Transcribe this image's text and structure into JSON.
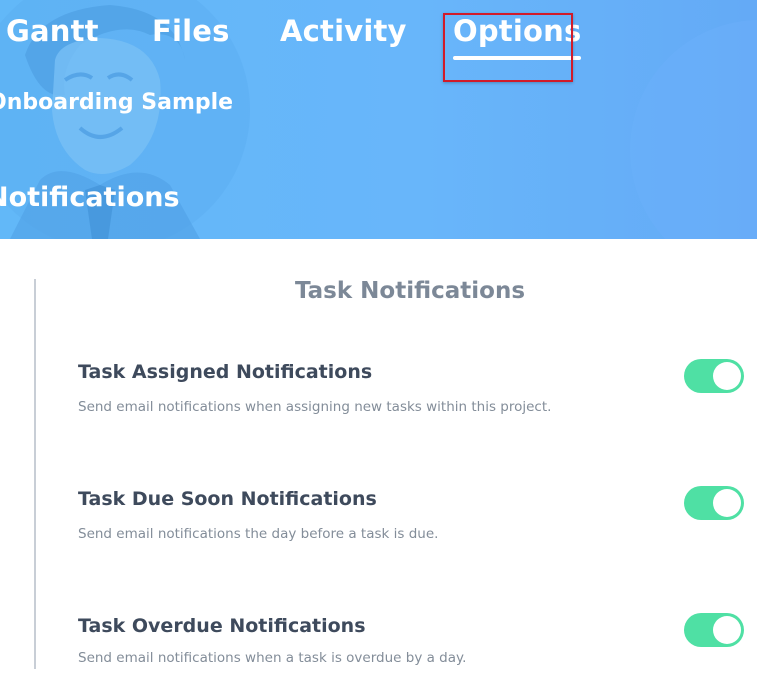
{
  "nav": {
    "tabs": [
      {
        "label": "Gantt"
      },
      {
        "label": "Files"
      },
      {
        "label": "Activity"
      },
      {
        "label": "Options",
        "active": true
      }
    ]
  },
  "header": {
    "project_title": "Onboarding Sample",
    "section_heading": "Notifications"
  },
  "panel": {
    "title": "Task Notifications",
    "settings": [
      {
        "name": "Task Assigned Notifications",
        "description": "Send email notifications when assigning new tasks within this project.",
        "enabled": true
      },
      {
        "name": "Task Due Soon Notifications",
        "description": "Send email notifications the day before a task is due.",
        "enabled": true
      },
      {
        "name": "Task Overdue Notifications",
        "description": "Send email notifications when a task is overdue by a day.",
        "enabled": true
      }
    ]
  },
  "colors": {
    "header_blue": "#62b8f8",
    "toggle_on": "#4fe0a4",
    "focus_outline": "#d11b2a"
  }
}
